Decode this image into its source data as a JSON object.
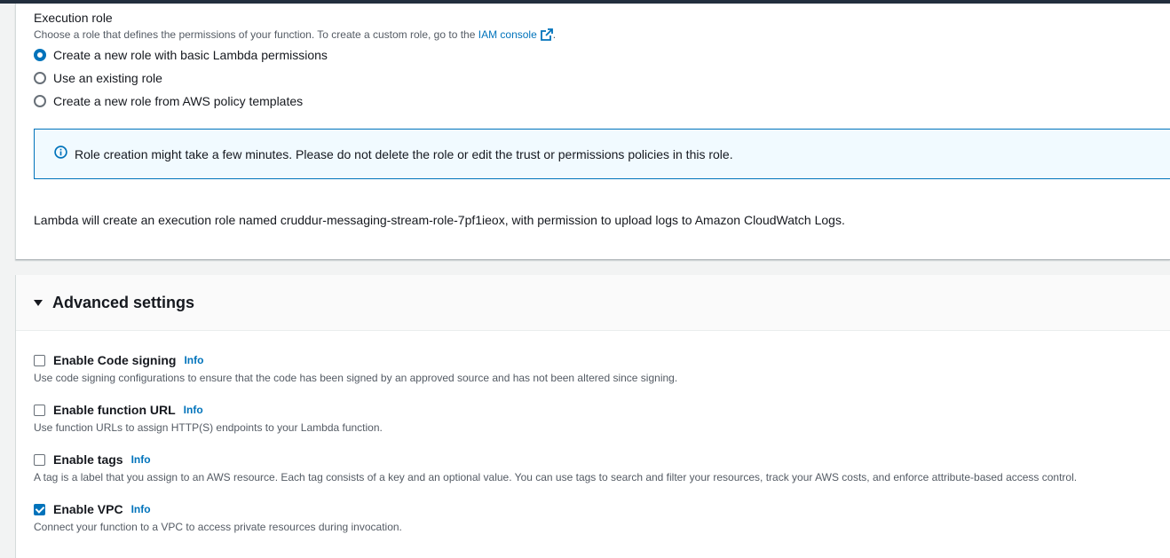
{
  "execution_role": {
    "title": "Execution role",
    "description": "Choose a role that defines the permissions of your function. To create a custom role, go to the",
    "link_text": "IAM console",
    "description_end": ".",
    "options": [
      {
        "label": "Create a new role with basic Lambda permissions",
        "selected": true
      },
      {
        "label": "Use an existing role",
        "selected": false
      },
      {
        "label": "Create a new role from AWS policy templates",
        "selected": false
      }
    ],
    "alert_text": "Role creation might take a few minutes. Please do not delete the role or edit the trust or permissions policies in this role.",
    "note": "Lambda will create an execution role named cruddur-messaging-stream-role-7pf1ieox, with permission to upload logs to Amazon CloudWatch Logs."
  },
  "advanced_settings": {
    "title": "Advanced settings",
    "expanded": true,
    "options": [
      {
        "label": "Enable Code signing",
        "info": "Info",
        "checked": false,
        "description": "Use code signing configurations to ensure that the code has been signed by an approved source and has not been altered since signing."
      },
      {
        "label": "Enable function URL",
        "info": "Info",
        "checked": false,
        "description": "Use function URLs to assign HTTP(S) endpoints to your Lambda function."
      },
      {
        "label": "Enable tags",
        "info": "Info",
        "checked": false,
        "description": "A tag is a label that you assign to an AWS resource. Each tag consists of a key and an optional value. You can use tags to search and filter your resources, track your AWS costs, and enforce attribute-based access control."
      },
      {
        "label": "Enable VPC",
        "info": "Info",
        "checked": true,
        "description": "Connect your function to a VPC to access private resources during invocation."
      }
    ]
  },
  "colors": {
    "accent": "#0073bb",
    "alert_bg": "#f1faff",
    "text": "#16191f",
    "muted": "#545b64"
  },
  "icons": {
    "external_link": "external-link-icon",
    "info": "info-circle-icon",
    "caret": "caret-down-icon"
  }
}
